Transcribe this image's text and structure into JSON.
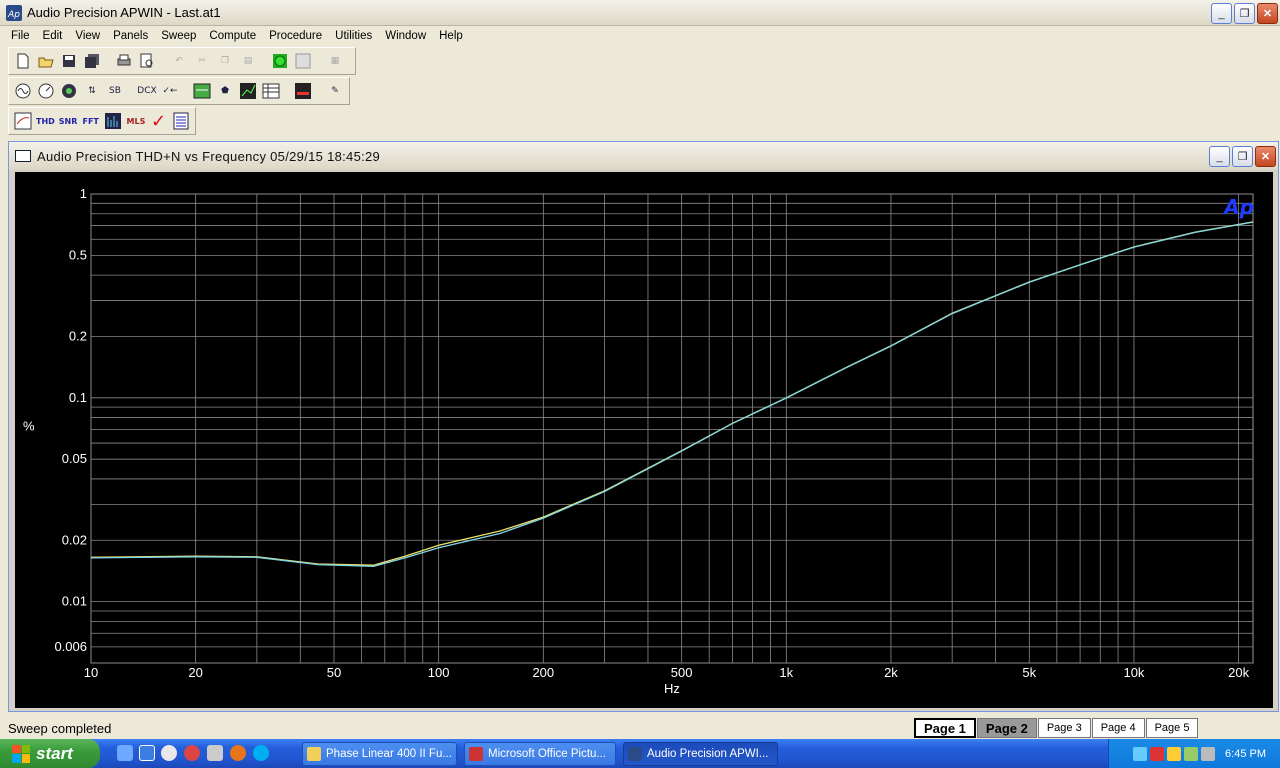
{
  "window": {
    "title": "Audio Precision APWIN - Last.at1",
    "controls": {
      "minimize": "_",
      "restore": "❐",
      "close": "✕"
    }
  },
  "menu": [
    "File",
    "Edit",
    "View",
    "Panels",
    "Sweep",
    "Compute",
    "Procedure",
    "Utilities",
    "Window",
    "Help"
  ],
  "toolbar": {
    "row1": [
      "new-icon",
      "open-icon",
      "save-icon",
      "save-all-icon",
      "print-icon",
      "print-preview-icon",
      "undo-icon",
      "cut-icon",
      "copy-icon",
      "paste-icon",
      "go-icon",
      "stop-icon",
      "panel-icon"
    ],
    "row2": [
      "generator-icon",
      "analyzer-icon",
      "dcx-icon",
      "switcher-icon",
      "stat-bit-icon",
      "dcx2-icon",
      "sweep-arrow-icon",
      "monitor-icon",
      "level-icon",
      "graph-icon",
      "data-icon",
      "display-icon",
      "edit-icon"
    ],
    "row3": [
      "graph-panel-icon",
      "thd-icon",
      "snr-icon",
      "fft-icon",
      "bargraph-icon",
      "mls-icon",
      "check-icon",
      "list-icon"
    ],
    "labels": {
      "stat": "STAT\nBIT",
      "dcx": "DCX",
      "thd": "THD",
      "snr": "SNR",
      "fft": "FFT",
      "mls": "MLS"
    }
  },
  "graph_window": {
    "title": "Audio Precision  THD+N vs Frequency  05/29/15 18:45:29",
    "logo": "Ap"
  },
  "chart_data": {
    "type": "line",
    "title": "",
    "xlabel": "Hz",
    "ylabel": "%",
    "xscale": "log",
    "yscale": "log",
    "xlim": [
      10,
      22000
    ],
    "ylim": [
      0.005,
      1
    ],
    "x_ticks": [
      {
        "v": 10,
        "label": "10"
      },
      {
        "v": 20,
        "label": "20"
      },
      {
        "v": 50,
        "label": "50"
      },
      {
        "v": 100,
        "label": "100"
      },
      {
        "v": 200,
        "label": "200"
      },
      {
        "v": 500,
        "label": "500"
      },
      {
        "v": 1000,
        "label": "1k"
      },
      {
        "v": 2000,
        "label": "2k"
      },
      {
        "v": 5000,
        "label": "5k"
      },
      {
        "v": 10000,
        "label": "10k"
      },
      {
        "v": 20000,
        "label": "20k"
      }
    ],
    "y_ticks": [
      {
        "v": 1,
        "label": "1"
      },
      {
        "v": 0.5,
        "label": "0.5"
      },
      {
        "v": 0.2,
        "label": "0.2"
      },
      {
        "v": 0.1,
        "label": "0.1"
      },
      {
        "v": 0.05,
        "label": "0.05"
      },
      {
        "v": 0.02,
        "label": "0.02"
      },
      {
        "v": 0.01,
        "label": "0.01"
      },
      {
        "v": 0.006,
        "label": "0.006"
      }
    ],
    "grid": true,
    "background": "#000000",
    "series": [
      {
        "color": "#f0e26a",
        "x": [
          10,
          20,
          30,
          45,
          65,
          80,
          100,
          150,
          200,
          300,
          500,
          700,
          1000,
          1500,
          2000,
          3000,
          5000,
          7000,
          10000,
          15000,
          22000
        ],
        "y": [
          0.0165,
          0.0167,
          0.0166,
          0.0153,
          0.0151,
          0.0167,
          0.0189,
          0.0222,
          0.026,
          0.035,
          0.055,
          0.075,
          0.1,
          0.142,
          0.18,
          0.26,
          0.37,
          0.45,
          0.55,
          0.65,
          0.73
        ]
      },
      {
        "color": "#7fd6e6",
        "x": [
          10,
          20,
          30,
          45,
          65,
          80,
          100,
          150,
          200,
          300,
          500,
          700,
          1000,
          1500,
          2000,
          3000,
          5000,
          7000,
          10000,
          15000,
          22000
        ],
        "y": [
          0.0164,
          0.0166,
          0.0165,
          0.0152,
          0.0149,
          0.0164,
          0.0184,
          0.0216,
          0.0257,
          0.0347,
          0.0548,
          0.0749,
          0.0998,
          0.1415,
          0.1795,
          0.259,
          0.369,
          0.449,
          0.549,
          0.648,
          0.728
        ]
      }
    ]
  },
  "status": {
    "message": "Sweep completed"
  },
  "pages": [
    "Page 1",
    "Page 2",
    "Page 3",
    "Page 4",
    "Page 5"
  ],
  "taskbar": {
    "start_label": "start",
    "tasks": [
      "Phase Linear 400 II Fu...",
      "Microsoft Office Pictu...",
      "Audio Precision APWI..."
    ],
    "clock": "6:45 PM"
  }
}
